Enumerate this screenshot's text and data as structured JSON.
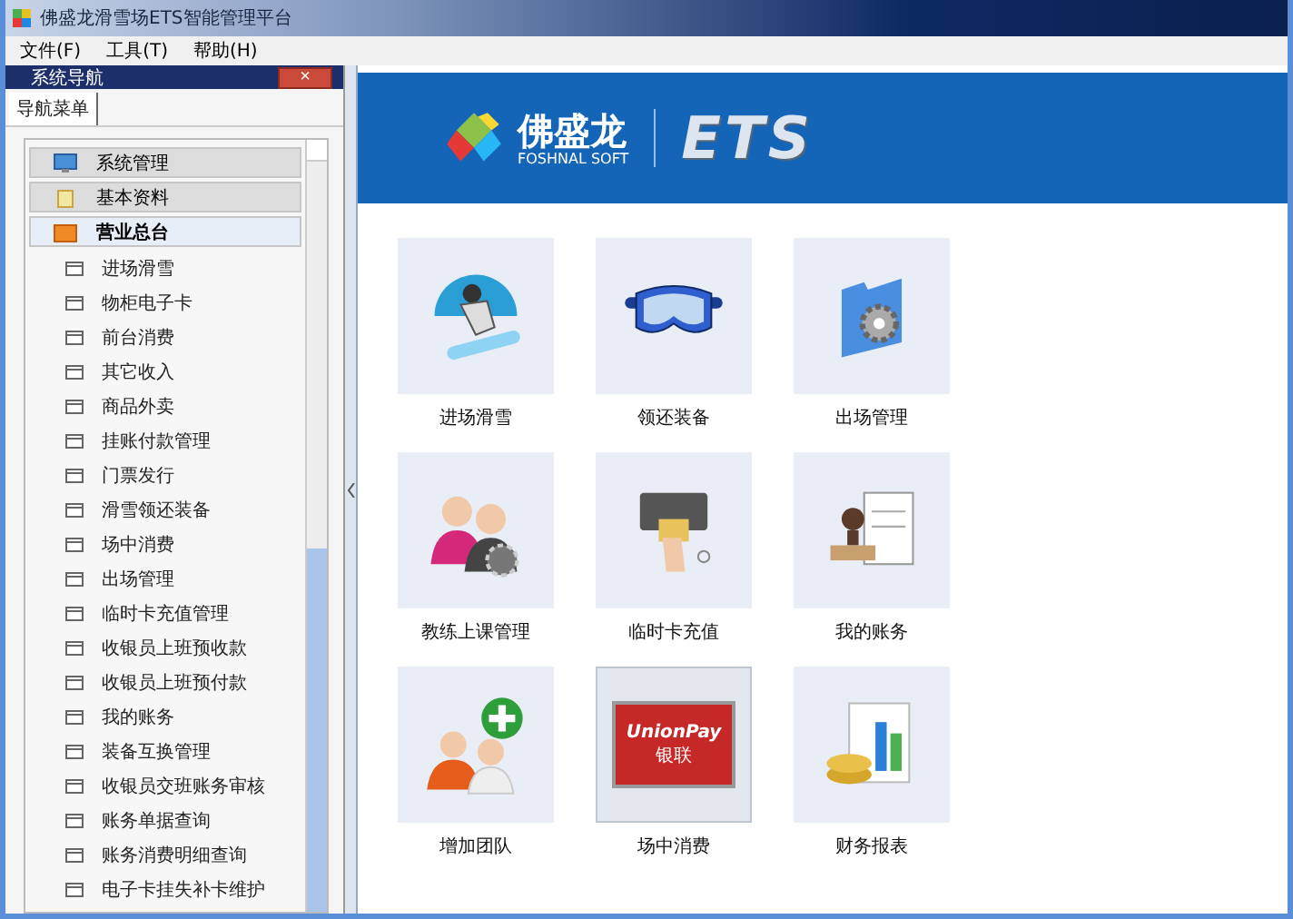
{
  "window": {
    "title": "佛盛龙滑雪场ETS智能管理平台"
  },
  "menu": [
    "文件(F)",
    "工具(T)",
    "帮助(H)"
  ],
  "nav": {
    "title": "系统导航",
    "close": "×",
    "tabs": [
      {
        "label": "导航菜单",
        "selected": true
      }
    ],
    "groups": [
      {
        "label": "系统管理",
        "kind": "monitor",
        "expanded": false
      },
      {
        "label": "基本资料",
        "kind": "folder",
        "expanded": false
      },
      {
        "label": "营业总台",
        "kind": "box",
        "expanded": true,
        "children": [
          "进场滑雪",
          "物柜电子卡",
          "前台消费",
          "其它收入",
          "商品外卖",
          "挂账付款管理",
          "门票发行",
          "滑雪领还装备",
          "场中消费",
          "出场管理",
          "临时卡充值管理",
          "收银员上班预收款",
          "收银员上班预付款",
          "我的账务",
          "装备互换管理",
          "收银员交班账务审核",
          "账务单据查询",
          "账务消费明细查询",
          "电子卡挂失补卡维护"
        ]
      }
    ]
  },
  "banner": {
    "brand": "佛盛龙",
    "sub": "FOSHNAL SOFT",
    "product": "ETS"
  },
  "tiles": [
    {
      "label": "进场滑雪",
      "kind": "snowboard",
      "selected": false
    },
    {
      "label": "领还装备",
      "kind": "goggles",
      "selected": false
    },
    {
      "label": "出场管理",
      "kind": "folder",
      "selected": false
    },
    {
      "label": "教练上课管理",
      "kind": "people",
      "selected": false
    },
    {
      "label": "临时卡充值",
      "kind": "card",
      "selected": false
    },
    {
      "label": "我的账务",
      "kind": "stamp",
      "selected": false
    },
    {
      "label": "增加团队",
      "kind": "addteam",
      "selected": false
    },
    {
      "label": "场中消费",
      "kind": "unionpay",
      "selected": true
    },
    {
      "label": "财务报表",
      "kind": "report",
      "selected": false
    }
  ],
  "bank_card": {
    "brand": "UnionPay",
    "brand_chinese": "银联"
  }
}
